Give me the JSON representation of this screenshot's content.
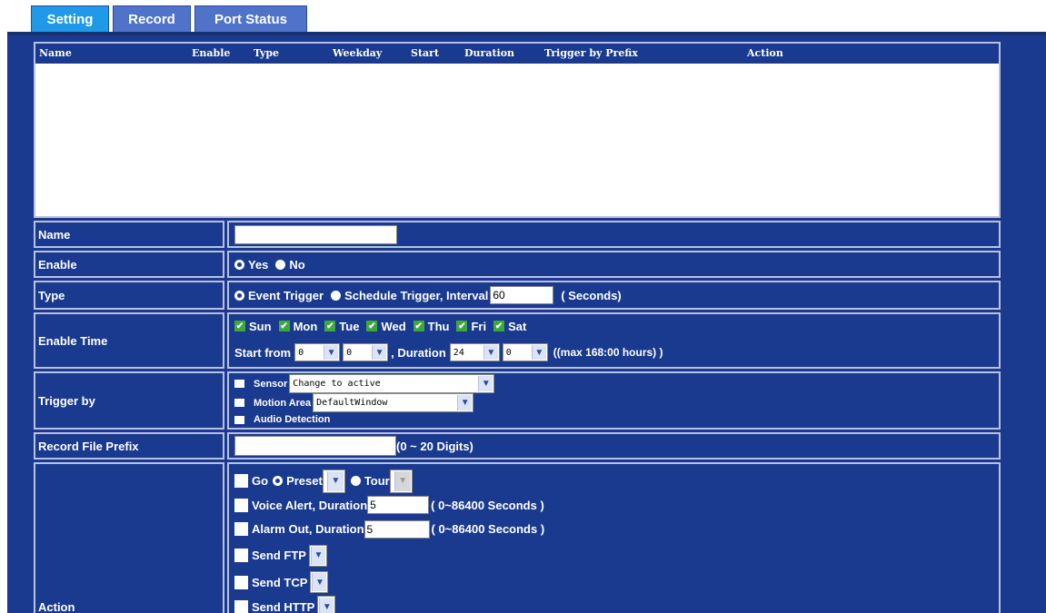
{
  "tabs": [
    {
      "label": "Setting",
      "active": true
    },
    {
      "label": "Record",
      "active": false
    },
    {
      "label": "Port Status",
      "active": false
    }
  ],
  "list": {
    "columns": [
      "Name",
      "Enable",
      "Type",
      "Weekday",
      "Start",
      "Duration",
      "Trigger by Prefix",
      "Action"
    ]
  },
  "form": {
    "name": {
      "label": "Name",
      "value": ""
    },
    "enable": {
      "label": "Enable",
      "yes": "Yes",
      "no": "No",
      "selected": "Yes"
    },
    "type": {
      "label": "Type",
      "event": "Event Trigger",
      "schedule": "Schedule Trigger, Interval",
      "interval": "60",
      "unit": "( Seconds)",
      "selected": "Event Trigger"
    },
    "enable_time": {
      "label": "Enable Time",
      "days": [
        {
          "label": "Sun",
          "checked": true
        },
        {
          "label": "Mon",
          "checked": true
        },
        {
          "label": "Tue",
          "checked": true
        },
        {
          "label": "Wed",
          "checked": true
        },
        {
          "label": "Thu",
          "checked": true
        },
        {
          "label": "Fri",
          "checked": true
        },
        {
          "label": "Sat",
          "checked": true
        }
      ],
      "start_label": "Start from",
      "start_hour": "0",
      "start_min": "0",
      "duration_label": ", Duration",
      "duration_hour": "24",
      "duration_min": "0",
      "max_note": "((max 168:00 hours) )"
    },
    "trigger_by": {
      "label": "Trigger by",
      "sensor": "Sensor",
      "sensor_value": "Change to active",
      "motion": "Motion Area",
      "motion_value": "DefaultWindow",
      "audio": "Audio Detection"
    },
    "prefix": {
      "label": "Record File Prefix",
      "value": "",
      "hint": "(0 ~ 20 Digits)"
    },
    "action": {
      "label": "Action",
      "go": "Go",
      "preset": "Preset",
      "tour": "Tour",
      "voice": "Voice Alert, Duration",
      "voice_value": "5",
      "voice_hint": "( 0~86400 Seconds )",
      "alarm": "Alarm Out, Duration",
      "alarm_value": "5",
      "alarm_hint": "( 0~86400 Seconds )",
      "ftp": "Send FTP",
      "tcp": "Send TCP",
      "http": "Send HTTP"
    }
  },
  "colors": {
    "panel": "#1a3a8f",
    "tab": "#4f73c8",
    "tab_active": "#1f9ae8",
    "check": "#3fa83c"
  }
}
